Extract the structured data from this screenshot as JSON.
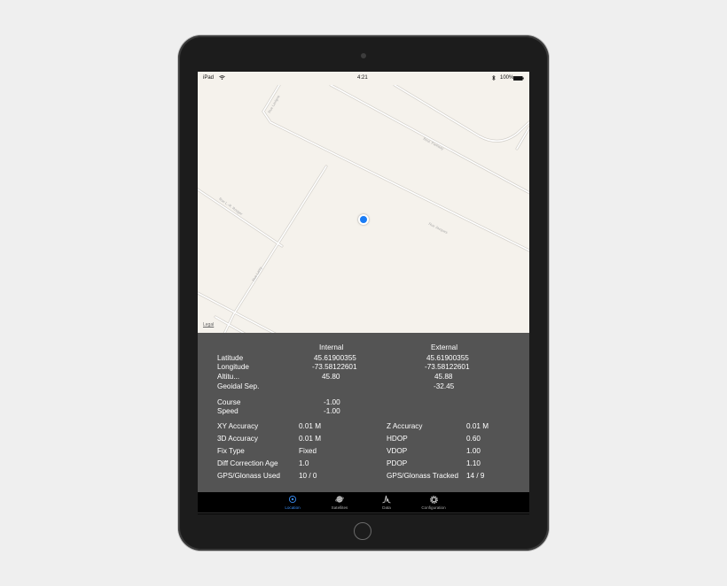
{
  "status": {
    "device": "iPad",
    "time": "4:21",
    "battery": "100%"
  },
  "map": {
    "legal": "Legal",
    "roads": [
      "Rue Lavigne",
      "Rue L.-R. Rouger",
      "Rue Jacques",
      "Rue Lamy",
      "Boul. Parkway"
    ]
  },
  "panel": {
    "col_internal": "Internal",
    "col_external": "External",
    "latitude_label": "Latitude",
    "latitude_int": "45.61900355",
    "latitude_ext": "45.61900355",
    "longitude_label": "Longitude",
    "longitude_int": "-73.58122601",
    "longitude_ext": "-73.58122601",
    "altitude_label": "Altitu...",
    "altitude_int": "45.80",
    "altitude_ext": "45.88",
    "geoidal_label": "Geoidal Sep.",
    "geoidal_ext": "-32.45",
    "course_label": "Course",
    "course_int": "-1.00",
    "speed_label": "Speed",
    "speed_int": "-1.00",
    "xy_acc_label": "XY Accuracy",
    "xy_acc": "0.01 M",
    "z_acc_label": "Z Accuracy",
    "z_acc": "0.01 M",
    "acc3d_label": "3D Accuracy",
    "acc3d": "0.01 M",
    "hdop_label": "HDOP",
    "hdop": "0.60",
    "fix_label": "Fix Type",
    "fix": "Fixed",
    "vdop_label": "VDOP",
    "vdop": "1.00",
    "diff_label": "Diff Correction Age",
    "diff": "1.0",
    "pdop_label": "PDOP",
    "pdop": "1.10",
    "used_label": "GPS/Glonass Used",
    "used": "10 /  0",
    "tracked_label": "GPS/Glonass Tracked",
    "tracked": "14 /  9"
  },
  "tabs": [
    {
      "label": "Location",
      "icon": "location-icon"
    },
    {
      "label": "Satellites",
      "icon": "satellite-icon"
    },
    {
      "label": "Data",
      "icon": "data-chart-icon"
    },
    {
      "label": "Configuration",
      "icon": "gear-icon"
    }
  ],
  "colors": {
    "accent": "#3a8ef6",
    "panel": "#545454",
    "map": "#f5f2ec"
  }
}
